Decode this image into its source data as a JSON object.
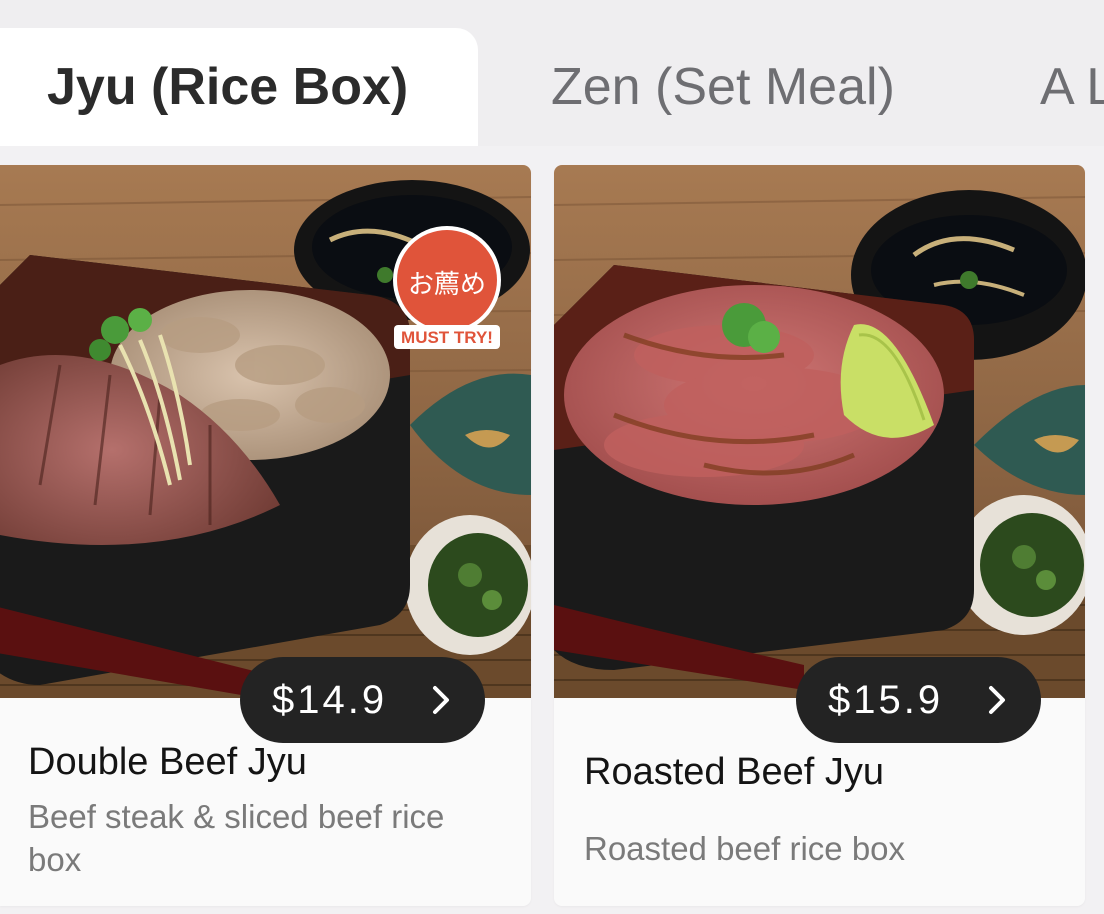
{
  "tabs": [
    {
      "label": "Jyu (Rice Box)",
      "active": true
    },
    {
      "label": "Zen (Set Meal)",
      "active": false
    },
    {
      "label": "A L",
      "active": false
    }
  ],
  "menu_items": [
    {
      "price": "$14.9",
      "name": "Double Beef Jyu",
      "description": "Beef steak & sliced beef rice box",
      "badge": {
        "text_jp": "お薦め",
        "text_en": "MUST TRY!"
      }
    },
    {
      "price": "$15.9",
      "name": "Roasted Beef Jyu",
      "description": "Roasted beef rice box"
    }
  ],
  "colors": {
    "active_tab_text": "#2b2b2b",
    "inactive_tab_text": "#6e6e72",
    "price_pill": "#232323",
    "badge": "#e0543a"
  }
}
